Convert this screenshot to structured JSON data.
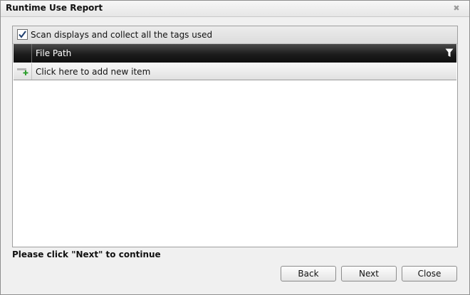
{
  "window": {
    "title": "Runtime Use Report",
    "close_icon": "close-icon"
  },
  "scan_option": {
    "label": "Scan displays and collect all the tags used",
    "checked": true
  },
  "grid": {
    "columns": [
      "File Path"
    ],
    "add_row_label": "Click here to add new item",
    "rows": []
  },
  "footer": {
    "message": "Please click \"Next\" to continue"
  },
  "buttons": {
    "back": "Back",
    "next": "Next",
    "close": "Close"
  }
}
